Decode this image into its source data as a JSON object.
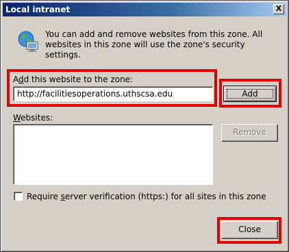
{
  "window": {
    "title": "Local intranet",
    "close_glyph": "X"
  },
  "intro": {
    "icon": "globe-computer-icon",
    "text": "You can add and remove websites from this zone. All websites in this zone will use the zone's security settings."
  },
  "add_section": {
    "label_prefix": "A",
    "label_access": "d",
    "label_rest": "d this website to the zone:",
    "url_value": "http://facilitiesoperations.uthscsa.edu",
    "add_label": "Add"
  },
  "websites": {
    "label_access": "W",
    "label_rest": "ebsites:",
    "items": [],
    "remove_label": "Remove"
  },
  "verification": {
    "label_pre": "Require ",
    "label_access": "s",
    "label_rest": "erver verification (https:) for all sites in this zone",
    "checked": false
  },
  "footer": {
    "close_label": "Close"
  },
  "colors": {
    "highlight": "#e00000",
    "titlebar": "#0a246a",
    "dialog_bg": "#d4d0c8"
  }
}
